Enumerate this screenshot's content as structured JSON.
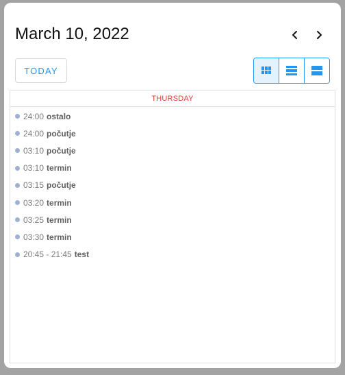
{
  "header": {
    "title": "March 10, 2022"
  },
  "nav": {
    "prev_icon": "chevron-left-icon",
    "next_icon": "chevron-right-icon"
  },
  "toolbar": {
    "today_label": "TODAY",
    "views": [
      {
        "name": "grid-view-icon",
        "active": true
      },
      {
        "name": "list-view-icon",
        "active": false
      },
      {
        "name": "split-view-icon",
        "active": false
      }
    ]
  },
  "day": {
    "weekday": "THURSDAY",
    "events": [
      {
        "time": "24:00",
        "title": "ostalo"
      },
      {
        "time": "24:00",
        "title": "počutje"
      },
      {
        "time": "03:10",
        "title": "počutje"
      },
      {
        "time": "03:10",
        "title": "termin"
      },
      {
        "time": "03:15",
        "title": "počutje"
      },
      {
        "time": "03:20",
        "title": "termin"
      },
      {
        "time": "03:25",
        "title": "termin"
      },
      {
        "time": "03:30",
        "title": "termin"
      },
      {
        "time": "20:45 - 21:45",
        "title": "test"
      }
    ]
  },
  "colors": {
    "accent": "#2196f3",
    "weekday": "#e53935",
    "event_dot": "#9fb1cf",
    "backdrop": "#a3a3a3"
  }
}
